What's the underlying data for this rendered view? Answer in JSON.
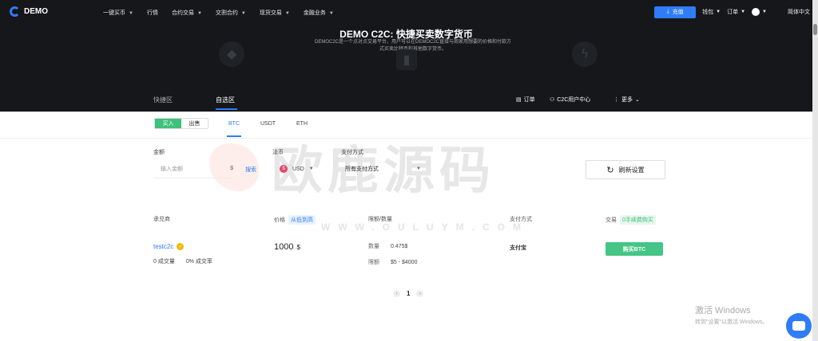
{
  "brand": {
    "name": "DEMO"
  },
  "nav": {
    "items": [
      {
        "label": "一键买币",
        "caret": true
      },
      {
        "label": "行情",
        "caret": false
      },
      {
        "label": "合约交易",
        "caret": true
      },
      {
        "label": "交割合约",
        "caret": true
      },
      {
        "label": "现货交易",
        "caret": true
      },
      {
        "label": "金融业务",
        "caret": true
      }
    ],
    "recharge": "充值",
    "wallet": "钱包",
    "orders": "订单",
    "language": "简体中文"
  },
  "banner": {
    "title": "DEMO C2C: 快捷买卖数字货币",
    "desc": "DEMOC2C是一个点对点交易平台，用户可以在DEMOC2C直接与商家用想要的价格和付款方式买卖比特币和其他数字货币。"
  },
  "tabs": {
    "quick": "快捷区",
    "custom": "自选区",
    "order": "订单",
    "c2c_center": "C2C用户中心",
    "more": "更多"
  },
  "trade": {
    "buy": "买入",
    "sell": "出售",
    "coins": [
      "BTC",
      "USDT",
      "ETH"
    ]
  },
  "filters": {
    "amount_label": "金额",
    "amount_placeholder": "输入金额",
    "amount_unit": "$",
    "search": "搜索",
    "currency_label": "法币",
    "currency_value": "USD",
    "currency_icon": "$",
    "payment_label": "支付方式",
    "payment_value": "所有支付方式",
    "refresh": "刷新设置"
  },
  "table": {
    "headers": {
      "merchant": "承兑商",
      "price": "价格",
      "price_sort": "从低到高",
      "limit": "限额/数量",
      "method": "支付方式",
      "trade": "交易",
      "fee": "0手续费购买"
    },
    "rows": [
      {
        "merchant": "testc2c",
        "volume": "0 成交量",
        "rate": "0% 成交率",
        "price": "1000",
        "unit": "$",
        "qty_label": "数量",
        "qty": "0.475$",
        "limit_label": "限额",
        "limit": "$5 - $4000",
        "method": "支付宝",
        "action": "购买BTC"
      }
    ]
  },
  "pager": {
    "current": "1",
    "prev": "‹",
    "next": "›"
  },
  "watermark": {
    "cn": "欧鹿源码",
    "en": "WWW.OULUYM.COM"
  },
  "windows": {
    "line1": "激活 Windows",
    "line2": "转到\"设置\"以激活 Windows。"
  },
  "colors": {
    "accent": "#2f7cf6",
    "buy": "#3ec17a",
    "header": "#15171b"
  }
}
